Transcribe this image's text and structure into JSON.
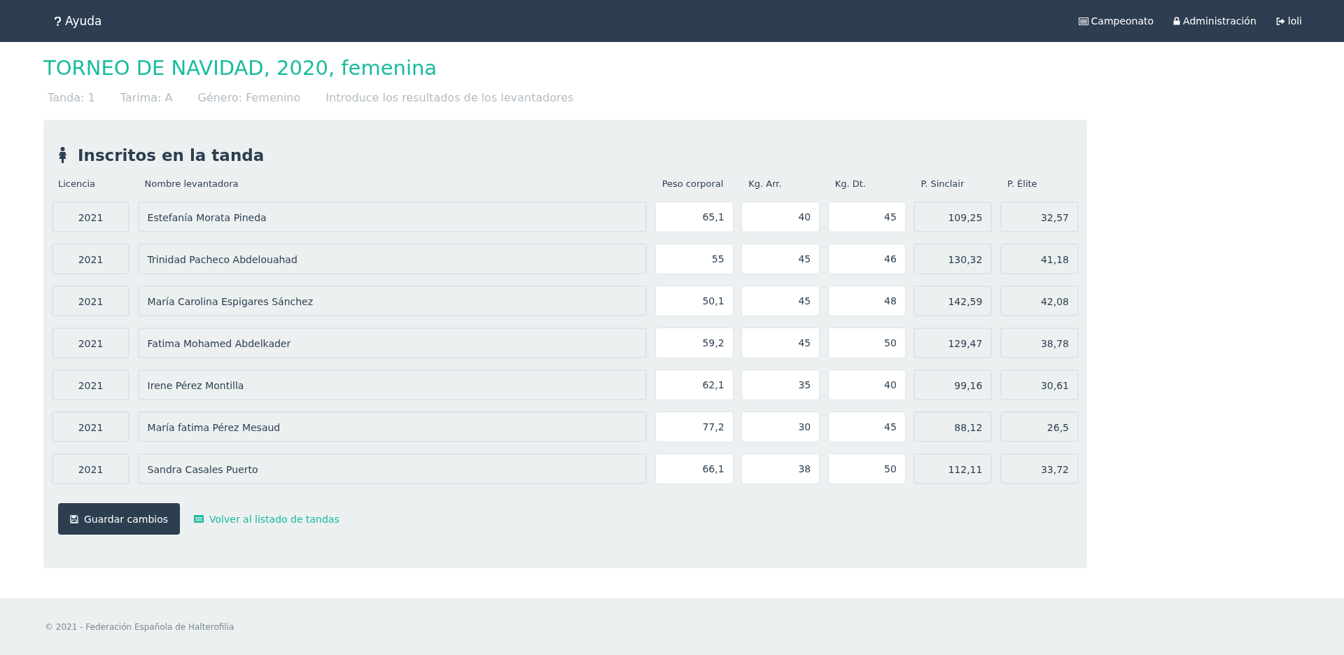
{
  "navbar": {
    "brand": "Ayuda",
    "links": [
      {
        "kind": "list",
        "label": "Campeonato"
      },
      {
        "kind": "lock",
        "label": "Administración"
      },
      {
        "kind": "logout",
        "label": "loli"
      }
    ]
  },
  "title": "TORNEO DE NAVIDAD, 2020, femenina",
  "subtitle": [
    "Tanda: 1",
    "Tarima: A",
    "Género: Femenino",
    "Introduce los resultados de los levantadores"
  ],
  "panel": {
    "heading": "Inscritos en la tanda",
    "columns": [
      {
        "label": "Licencia",
        "editable": false
      },
      {
        "label": "Nombre levantadora",
        "editable": false
      },
      {
        "label": "Peso corporal",
        "editable": true
      },
      {
        "label": "Kg. Arr.",
        "editable": true
      },
      {
        "label": "Kg. Dt.",
        "editable": true
      },
      {
        "label": "P. Sinclair",
        "editable": false
      },
      {
        "label": "P. Élite",
        "editable": false
      }
    ],
    "rows": [
      [
        "2021",
        "Estefanía Morata Pineda",
        "65,1",
        "40",
        "45",
        "109,25",
        "32,57"
      ],
      [
        "2021",
        "Trinidad Pacheco Abdelouahad",
        "55",
        "45",
        "46",
        "130,32",
        "41,18"
      ],
      [
        "2021",
        "María Carolina Espigares Sánchez",
        "50,1",
        "45",
        "48",
        "142,59",
        "42,08"
      ],
      [
        "2021",
        "Fatima Mohamed Abdelkader",
        "59,2",
        "45",
        "50",
        "129,47",
        "38,78"
      ],
      [
        "2021",
        "Irene Pérez Montilla",
        "62,1",
        "35",
        "40",
        "99,16",
        "30,61"
      ],
      [
        "2021",
        "María fatima Pérez Mesaud",
        "77,2",
        "30",
        "45",
        "88,12",
        "26,5"
      ],
      [
        "2021",
        "Sandra Casales Puerto",
        "66,1",
        "38",
        "50",
        "112,11",
        "33,72"
      ]
    ],
    "save_button": "Guardar cambios",
    "back_link": "Volver al listado de tandas"
  },
  "footer": "© 2021 - Federación Española de Halterofilia"
}
